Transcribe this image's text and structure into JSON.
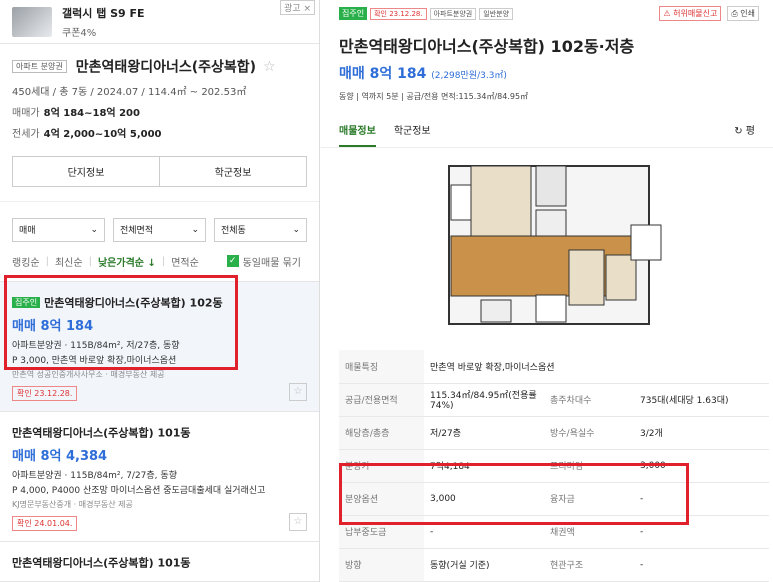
{
  "ad": {
    "title": "갤럭시 탭 S9 FE",
    "sub": "쿠폰4%",
    "close": "광고 ×"
  },
  "complex": {
    "tag": "아파트 분양권",
    "title": "만촌역태왕디아너스(주상복합)",
    "info": "450세대 / 총 7동 / 2024.07 / 114.4㎡ ~ 202.53㎡",
    "sale_label": "매매가",
    "sale_value": "8억 184~18억 200",
    "lease_label": "전세가",
    "lease_value": "4억 2,000~10억 5,000",
    "btn_complex": "단지정보",
    "btn_school": "학군정보"
  },
  "filters": {
    "f1": "매매",
    "f2": "전체면적",
    "f3": "전체동"
  },
  "sort": {
    "s1": "랭킹순",
    "s2": "최신순",
    "s3": "낮은가격순 ↓",
    "s4": "면적순",
    "check": "동일매물 묶기"
  },
  "items": [
    {
      "badge": "집주인",
      "title": "만촌역태왕디아너스(주상복합) 102동",
      "price": "매매 8억 184",
      "desc": "아파트분양권 · 115B/84m², 저/27층, 동향",
      "desc2": "P 3,000, 만촌역 바로앞 확장,마이너스옵션",
      "src": "만촌역 성공인중개사사무소 · 매경부동산 제공",
      "confirm": "확인 23.12.28."
    },
    {
      "badge": "",
      "title": "만촌역태왕디아너스(주상복합) 101동",
      "price": "매매 8억 4,384",
      "desc": "아파트분양권 · 115B/84m², 7/27층, 동향",
      "desc2": "P 4,000, P4000 산조망 마이너스옵션 중도금대출세대 실거래신고",
      "src": "KJ명문부동산중개 · 매경부동산 제공",
      "confirm": "확인 24.01.04."
    },
    {
      "badge": "",
      "title": "만촌역태왕디아너스(주상복합) 101동",
      "price": "",
      "desc": "",
      "desc2": "",
      "src": "",
      "confirm": ""
    }
  ],
  "detail": {
    "badge": "집주인",
    "confirm": "확인 23.12.28.",
    "tag1": "아파트분양권",
    "tag2": "일반분양",
    "report": "허위매물신고",
    "print": "인쇄",
    "title": "만촌역태왕디아너스(주상복합) 102동·저층",
    "price": "매매 8억 184",
    "price_unit": "(2,298만원/3.3㎡)",
    "sub": "동향 | 역까지 5분 | 공급/전용 면적:115.34㎡/84.95㎡",
    "tab1": "매물정보",
    "tab2": "학군정보",
    "tab3": "평",
    "rows": [
      {
        "k1": "매물특징",
        "v1": "만촌역 바로앞 확장,마이너스옵션",
        "k2": "",
        "v2": ""
      },
      {
        "k1": "공급/전용면적",
        "v1": "115.34㎡/84.95㎡(전용률74%)",
        "k2": "총주차대수",
        "v2": "735대(세대당 1.63대)"
      },
      {
        "k1": "해당층/총층",
        "v1": "저/27층",
        "k2": "방수/욕실수",
        "v2": "3/2개"
      },
      {
        "k1": "분양가",
        "v1": "7억4,184",
        "k2": "프리미엄",
        "v2": "3,000"
      },
      {
        "k1": "분양옵션",
        "v1": "3,000",
        "k2": "융자금",
        "v2": "-"
      },
      {
        "k1": "납부중도금",
        "v1": "-",
        "k2": "채권액",
        "v2": "-"
      },
      {
        "k1": "방향",
        "v1": "동향(거실 기준)",
        "k2": "현관구조",
        "v2": "-"
      }
    ]
  },
  "colors": {
    "accent": "#2a7a2a",
    "price": "#2f6ed8",
    "highlight": "#e0202a"
  }
}
